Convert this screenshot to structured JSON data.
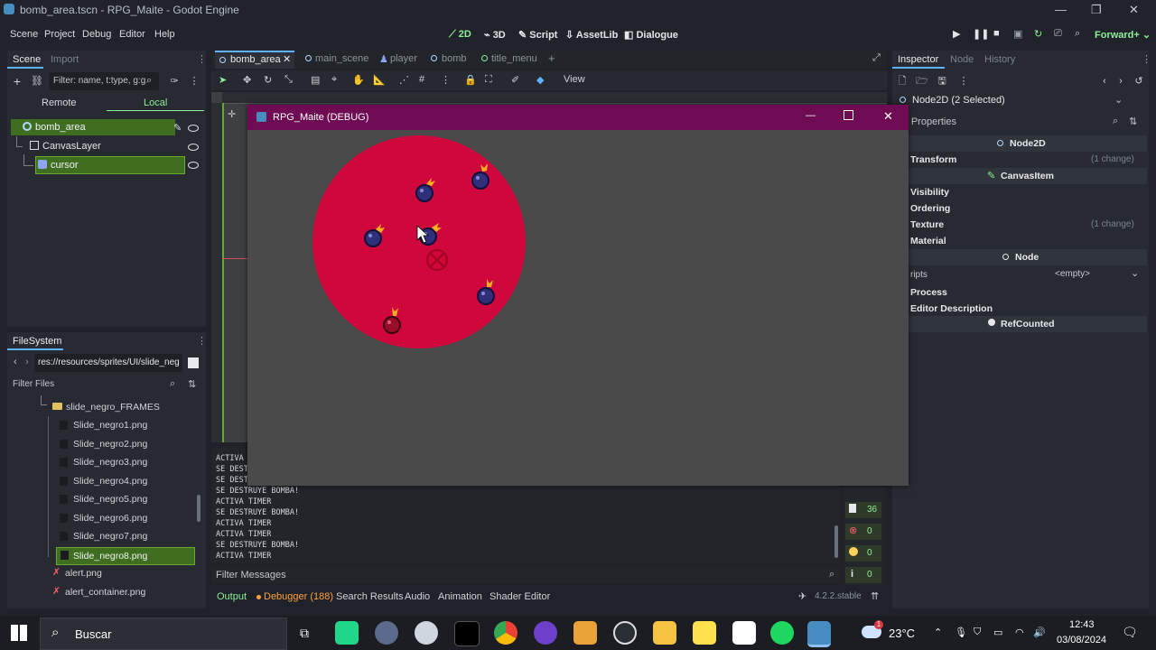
{
  "title_bar": {
    "title": "bomb_area.tscn - RPG_Maite - Godot Engine"
  },
  "menu": {
    "items": [
      "Scene",
      "Project",
      "Debug",
      "Editor",
      "Help"
    ],
    "modes": [
      "2D",
      "3D",
      "Script",
      "AssetLib",
      "Dialogue"
    ],
    "renderer": "Forward+"
  },
  "scene_dock": {
    "tabs": [
      "Scene",
      "Import"
    ],
    "filter_placeholder": "Filter: name, t:type, g:g",
    "remote_label": "Remote",
    "local_label": "Local",
    "nodes": [
      "bomb_area",
      "CanvasLayer",
      "cursor"
    ]
  },
  "filesystem": {
    "title": "FileSystem",
    "path": "res://resources/sprites/UI/slide_neg",
    "filter_placeholder": "Filter Files",
    "folder": "slide_negro_FRAMES",
    "files": [
      "Slide_negro1.png",
      "Slide_negro2.png",
      "Slide_negro3.png",
      "Slide_negro4.png",
      "Slide_negro5.png",
      "Slide_negro6.png",
      "Slide_negro7.png",
      "Slide_negro8.png"
    ],
    "extra_files": [
      "alert.png",
      "alert_container.png"
    ],
    "selected_file": "Slide_negro8.png"
  },
  "editor_tabs": [
    "bomb_area",
    "main_scene",
    "player",
    "bomb",
    "title_menu"
  ],
  "toolbar": {
    "view_label": "View"
  },
  "game_window": {
    "title": "RPG_Maite (DEBUG)",
    "circle_color": "#d0073d",
    "background_color": "#4a4a4a"
  },
  "console": {
    "lines": [
      "ACTIVA",
      "SE DESTR",
      "SE DESTR",
      "SE DESTRUYE BOMBA!",
      "ACTIVA TIMER",
      "SE DESTRUYE BOMBA!",
      "ACTIVA TIMER",
      "ACTIVA TIMER",
      "SE DESTRUYE BOMBA!",
      "ACTIVA TIMER"
    ],
    "filter_placeholder": "Filter Messages",
    "counts": {
      "messages": "36",
      "errors": "0",
      "warnings": "0",
      "info": "0"
    }
  },
  "bottom_tabs": [
    "Output",
    "Debugger (188)",
    "Search Results",
    "Audio",
    "Animation",
    "Shader Editor"
  ],
  "version": "4.2.2.stable",
  "inspector": {
    "tabs": [
      "Inspector",
      "Node",
      "History"
    ],
    "selected": "Node2D (2 Selected)",
    "filter_placeholder": "er Properties",
    "sections": {
      "node2d": "Node2D",
      "transform": "Transform",
      "transform_change": "(1 change)",
      "canvasitem": "CanvasItem",
      "visibility": "Visibility",
      "ordering": "Ordering",
      "texture": "Texture",
      "texture_change": "(1 change)",
      "material": "Material",
      "node": "Node",
      "scripts": "ripts",
      "scripts_value": "<empty>",
      "process": "Process",
      "editor_description": "Editor Description",
      "refcounted": "RefCounted"
    }
  },
  "taskbar": {
    "search_placeholder": "Buscar",
    "weather": "23°C",
    "time": "12:43",
    "date": "03/08/2024",
    "weather_badge": "1"
  },
  "colors": {
    "accent": "#5fb2ff",
    "selection": "#3f6e21",
    "game_title_bar": "#6e0b52"
  }
}
